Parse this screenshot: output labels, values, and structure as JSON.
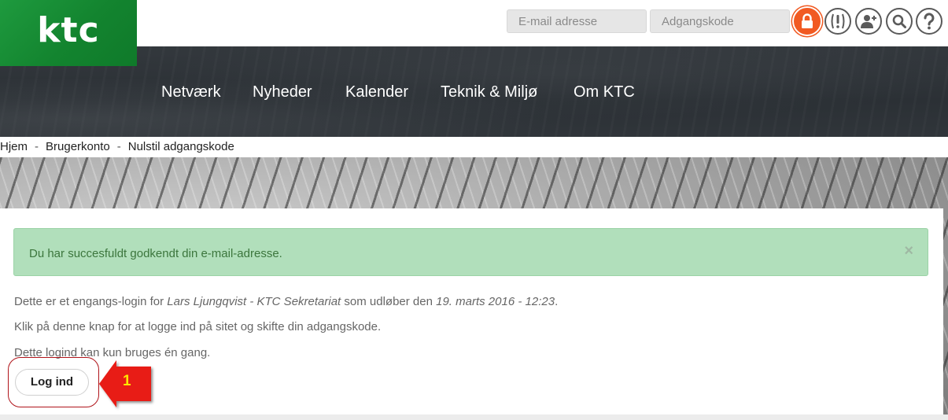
{
  "header": {
    "logo_text": "ktc",
    "email_placeholder": "E-mail adresse",
    "password_placeholder": "Adgangskode",
    "icons": [
      "lock-icon",
      "alert-icon",
      "add-user-icon",
      "search-icon",
      "help-icon"
    ],
    "accent_color": "#f15a22",
    "brand_color": "#13842f"
  },
  "nav": {
    "items": [
      {
        "label": "Netværk"
      },
      {
        "label": "Nyheder"
      },
      {
        "label": "Kalender"
      },
      {
        "label": "Teknik & Miljø"
      },
      {
        "label": "Om KTC"
      }
    ]
  },
  "breadcrumb": {
    "items": [
      {
        "label": "Hjem"
      },
      {
        "label": "Brugerkonto"
      },
      {
        "label": "Nulstil adgangskode"
      }
    ],
    "separator": "-"
  },
  "alert": {
    "message": "Du har succesfuldt godkendt din e-mail-adresse.",
    "close": "×",
    "color": "#b1dfbb"
  },
  "content": {
    "line1_prefix": "Dette er et engangs-login for ",
    "line1_user": "Lars Ljungqvist - KTC Sekretariat",
    "line1_middle": " som udløber den ",
    "line1_expiry": "19. marts 2016 - 12:23",
    "line1_suffix": ".",
    "line2": "Klik på denne knap for at logge ind på sitet og skifte din adgangskode.",
    "line3": "Dette logind kan kun bruges én gang.",
    "login_button": "Log ind"
  },
  "annotation": {
    "number": "1"
  }
}
